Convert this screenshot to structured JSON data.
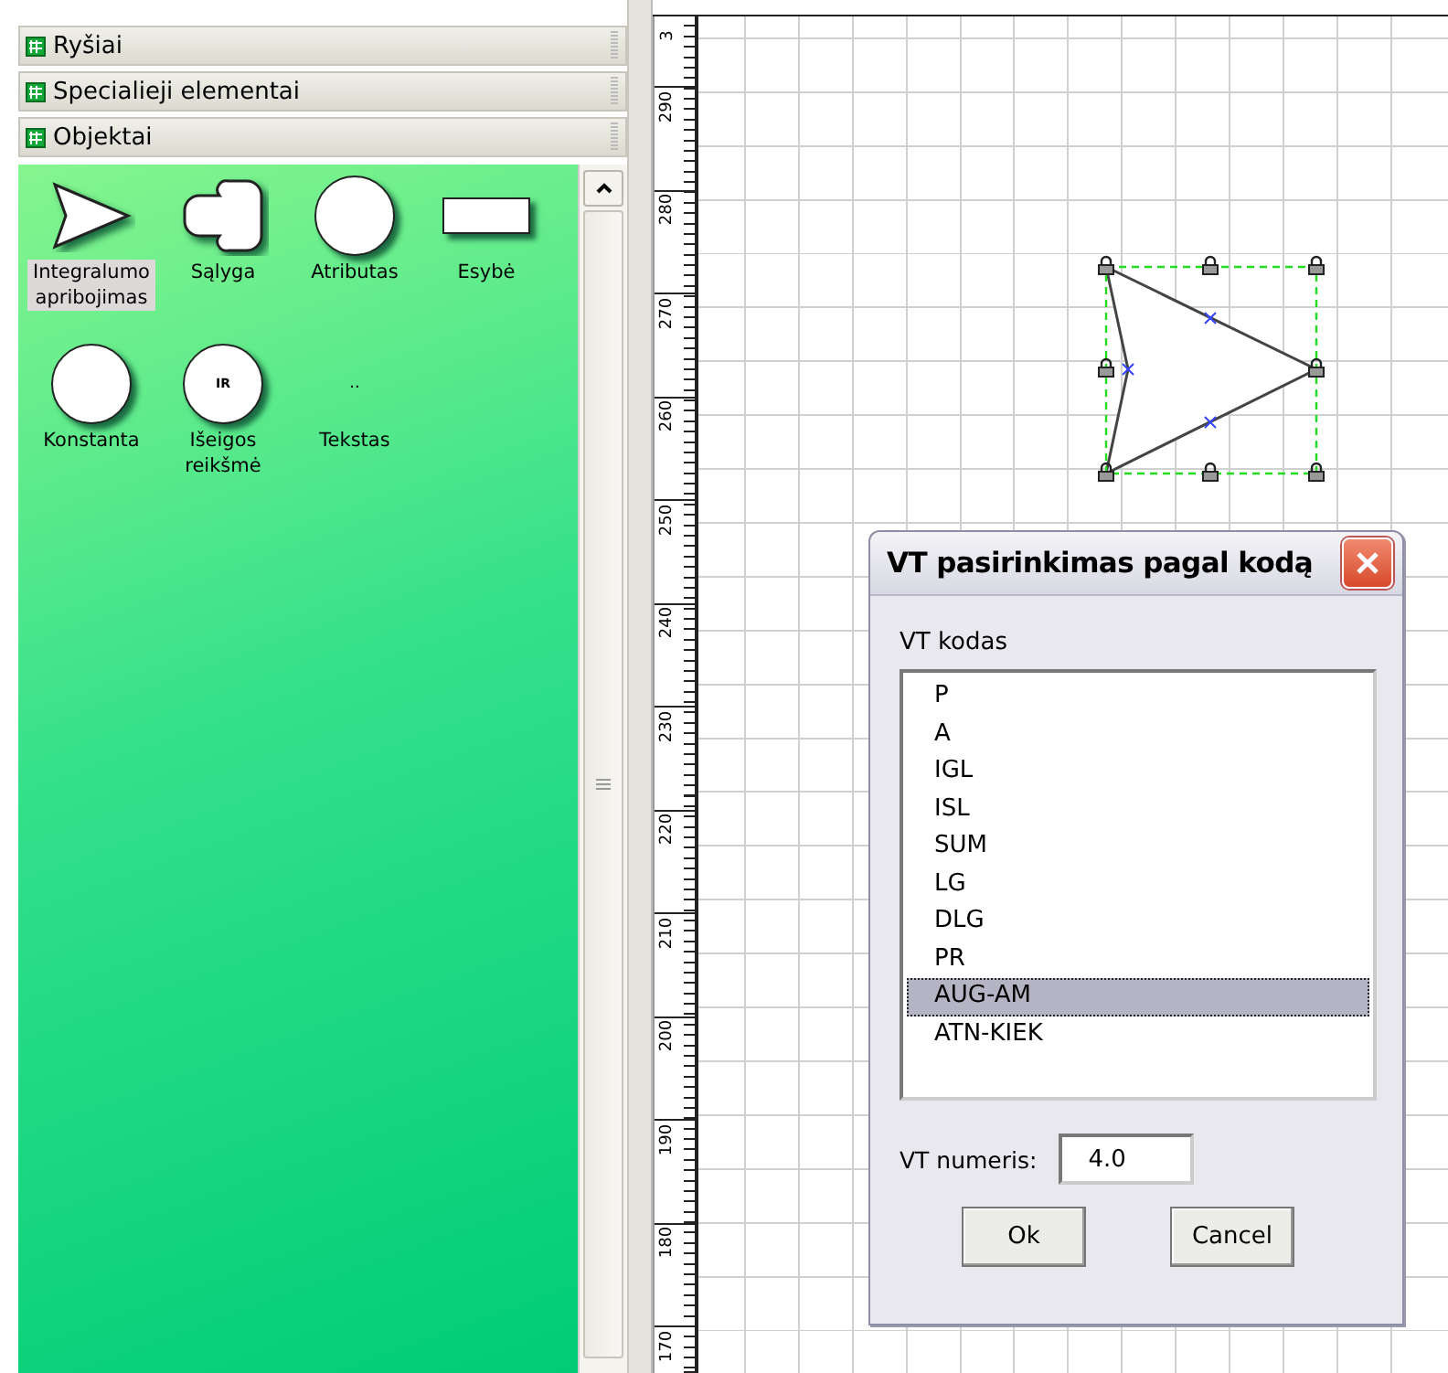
{
  "palette": {
    "sections": [
      {
        "label": "Ryšiai"
      },
      {
        "label": "Specialieji elementai"
      },
      {
        "label": "Objektai"
      }
    ],
    "items": [
      {
        "label": "Integralumo apribojimas",
        "kind": "triangle",
        "selected": true
      },
      {
        "label": "Sąlyga",
        "kind": "condition",
        "selected": false
      },
      {
        "label": "Atributas",
        "kind": "circle",
        "selected": false
      },
      {
        "label": "Esybė",
        "kind": "rectangle",
        "selected": false
      },
      {
        "label": "Konstanta",
        "kind": "circle",
        "selected": false
      },
      {
        "label": "Išeigos reikšmė",
        "kind": "circle",
        "icon_text": "IR",
        "selected": false
      },
      {
        "label": "Tekstas",
        "kind": "text",
        "icon_text": "..",
        "selected": false
      }
    ]
  },
  "ruler": {
    "labels": [
      "3",
      "290",
      "280",
      "270",
      "260",
      "250",
      "240",
      "230",
      "220",
      "210",
      "200",
      "190",
      "180",
      "170"
    ]
  },
  "canvas": {
    "shape": {
      "kind": "triangle",
      "selected": true
    }
  },
  "dialog": {
    "title": "VT pasirinkimas pagal kodą",
    "list_label": "VT kodas",
    "codes": [
      {
        "label": "P",
        "selected": false
      },
      {
        "label": "A",
        "selected": false
      },
      {
        "label": "IGL",
        "selected": false
      },
      {
        "label": "ISL",
        "selected": false
      },
      {
        "label": "SUM",
        "selected": false
      },
      {
        "label": "LG",
        "selected": false
      },
      {
        "label": "DLG",
        "selected": false
      },
      {
        "label": "PR",
        "selected": false
      },
      {
        "label": "AUG-AM",
        "selected": true
      },
      {
        "label": "ATN-KIEK",
        "selected": false
      }
    ],
    "number_label": "VT numeris:",
    "number_value": "4.0",
    "buttons": [
      "Ok",
      "Cancel"
    ]
  }
}
